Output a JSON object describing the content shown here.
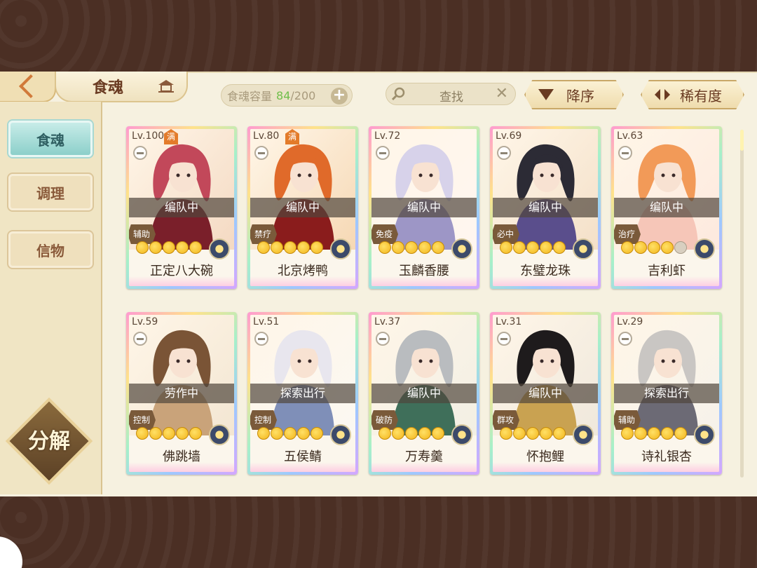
{
  "header": {
    "title": "食魂",
    "capacity_label": "食魂容量",
    "capacity_current": "84",
    "capacity_sep": "/",
    "capacity_max": "200",
    "plus_label": "+",
    "search_label": "查找",
    "search_clear": "✕",
    "sort_desc_label": "降序",
    "sort_rarity_label": "稀有度"
  },
  "sidebar": {
    "items": [
      {
        "label": "食魂"
      },
      {
        "label": "调理"
      },
      {
        "label": "信物"
      }
    ],
    "decompose_label": "分解"
  },
  "cards": [
    {
      "level": "Lv.100",
      "full": "满",
      "status": "编队中",
      "role": "辅助",
      "stars": 5,
      "name": "正定八大碗",
      "palette": [
        "#c2485a",
        "#7a1f2a",
        "#f4d9c2"
      ]
    },
    {
      "level": "Lv.80",
      "full": "满",
      "status": "编队中",
      "role": "禁疗",
      "stars": 5,
      "name": "北京烤鸭",
      "palette": [
        "#e06a2a",
        "#8a1c1c",
        "#f6d8b4"
      ]
    },
    {
      "level": "Lv.72",
      "full": "",
      "status": "编队中",
      "role": "免疫",
      "stars": 5,
      "name": "玉麟香腰",
      "palette": [
        "#d7d2ea",
        "#9d96c6",
        "#fff6f0"
      ]
    },
    {
      "level": "Lv.69",
      "full": "",
      "status": "编队中",
      "role": "必中",
      "stars": 5,
      "name": "东璧龙珠",
      "palette": [
        "#2c2b35",
        "#5a4e8c",
        "#f4e0c8"
      ]
    },
    {
      "level": "Lv.63",
      "full": "",
      "status": "编队中",
      "role": "治疗",
      "stars": 4,
      "name": "吉利虾",
      "palette": [
        "#f29a58",
        "#f6c6b8",
        "#fde9de"
      ]
    },
    {
      "level": "Lv.59",
      "full": "",
      "status": "劳作中",
      "role": "控制",
      "stars": 5,
      "name": "佛跳墙",
      "palette": [
        "#7a5436",
        "#c9a37a",
        "#f3e6d2"
      ]
    },
    {
      "level": "Lv.51",
      "full": "",
      "status": "探索出行",
      "role": "控制",
      "stars": 5,
      "name": "五侯鲭",
      "palette": [
        "#e8e6ee",
        "#7f8fb8",
        "#fbf8f2"
      ]
    },
    {
      "level": "Lv.37",
      "full": "",
      "status": "编队中",
      "role": "破防",
      "stars": 5,
      "name": "万寿羹",
      "palette": [
        "#b9bcbf",
        "#3f6f5a",
        "#f2efe4"
      ]
    },
    {
      "level": "Lv.31",
      "full": "",
      "status": "编队中",
      "role": "群攻",
      "stars": 5,
      "name": "怀抱鲤",
      "palette": [
        "#1e1b1c",
        "#c9a251",
        "#efe8dc"
      ]
    },
    {
      "level": "Lv.29",
      "full": "",
      "status": "探索出行",
      "role": "辅助",
      "stars": 5,
      "name": "诗礼银杏",
      "palette": [
        "#c9c6c3",
        "#6c6a75",
        "#f6f2ea"
      ]
    }
  ]
}
